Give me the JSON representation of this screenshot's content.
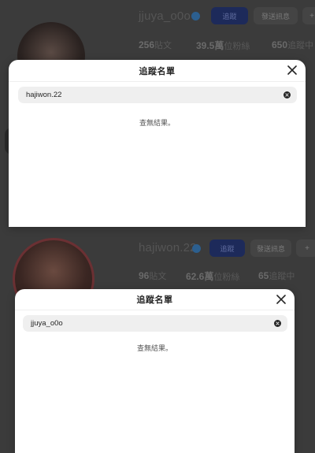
{
  "profiles": [
    {
      "username": "jjuya_o0o",
      "follow_label": "追蹤",
      "message_label": "發送訊息",
      "extra_label": "+",
      "stats": [
        {
          "value": "256",
          "label": "貼文"
        },
        {
          "value": "39.5萬",
          "label": "位粉絲"
        },
        {
          "value": "650",
          "label": "追蹤中"
        }
      ]
    },
    {
      "username": "hajiwon.22",
      "follow_label": "追蹤",
      "message_label": "發送訊息",
      "extra_label": "+",
      "stats": [
        {
          "value": "96",
          "label": "貼文"
        },
        {
          "value": "62.6萬",
          "label": "位粉絲"
        },
        {
          "value": "65",
          "label": "追蹤中"
        }
      ]
    }
  ],
  "modals": [
    {
      "title": "追蹤名單",
      "search_value": "hajiwon.22",
      "no_results": "查無結果。"
    },
    {
      "title": "追蹤名單",
      "search_value": "jjuya_o0o",
      "no_results": "查無結果。"
    }
  ],
  "colors": {
    "accent_follow": "#0095f6",
    "overlay": "#3b3b3b",
    "modal_bg": "#ffffff",
    "search_bg": "#efefef"
  }
}
